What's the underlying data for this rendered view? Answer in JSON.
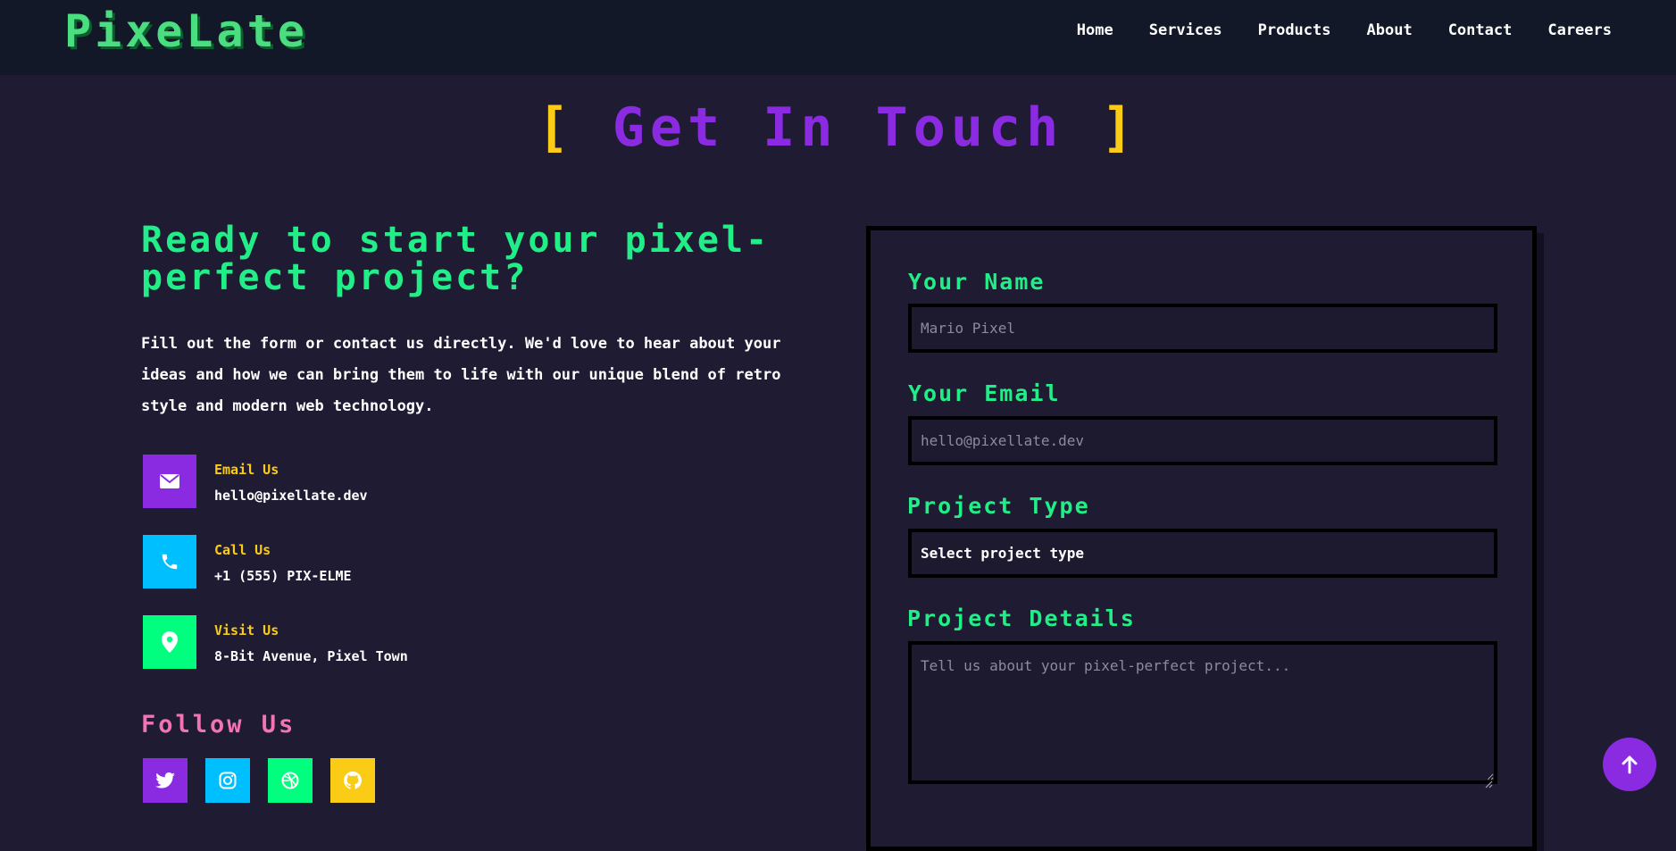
{
  "brand": {
    "logo": "PixeLate",
    "color": "#4ade80"
  },
  "nav": {
    "items": [
      {
        "label": "Home"
      },
      {
        "label": "Services"
      },
      {
        "label": "Products"
      },
      {
        "label": "About"
      },
      {
        "label": "Contact"
      },
      {
        "label": "Careers"
      }
    ]
  },
  "section": {
    "bracket_open": "[",
    "title": "Get In Touch",
    "bracket_close": "]",
    "title_color": "#8a2be2",
    "bracket_color": "#facc15"
  },
  "intro": {
    "heading": "Ready to start your pixel-perfect project?",
    "paragraph": "Fill out the form or contact us directly. We'd love to hear about your ideas and how we can bring them to life with our unique blend of retro style and modern web technology."
  },
  "contacts": [
    {
      "icon": "envelope-icon",
      "label": "Email Us",
      "value": "hello@pixellate.dev",
      "color": "#8a2be2"
    },
    {
      "icon": "phone-icon",
      "label": "Call Us",
      "value": "+1 (555) PIX-ELME",
      "color": "#00bfff"
    },
    {
      "icon": "map-pin-icon",
      "label": "Visit Us",
      "value": "8-Bit Avenue, Pixel Town",
      "color": "#00ff7f"
    }
  ],
  "follow": {
    "heading": "Follow Us",
    "socials": [
      {
        "icon": "twitter-icon",
        "color": "#8a2be2"
      },
      {
        "icon": "instagram-icon",
        "color": "#00bfff"
      },
      {
        "icon": "dribbble-icon",
        "color": "#00ff7f"
      },
      {
        "icon": "github-icon",
        "color": "#facc15"
      }
    ]
  },
  "form": {
    "name_label": "Your Name",
    "name_placeholder": "Mario Pixel",
    "email_label": "Your Email",
    "email_placeholder": "hello@pixellate.dev",
    "type_label": "Project Type",
    "type_selected": "Select project type",
    "details_label": "Project Details",
    "details_placeholder": "Tell us about your pixel-perfect project..."
  },
  "scroll_top": {
    "icon": "arrow-up-icon"
  }
}
